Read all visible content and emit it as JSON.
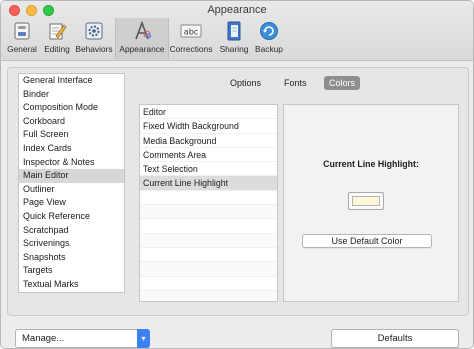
{
  "window": {
    "title": "Appearance"
  },
  "toolbar": [
    {
      "id": "general",
      "label": "General",
      "icon": "general-switch-icon"
    },
    {
      "id": "editing",
      "label": "Editing",
      "icon": "pencil-note-icon"
    },
    {
      "id": "behaviors",
      "label": "Behaviors",
      "icon": "gear-box-icon"
    },
    {
      "id": "appearance",
      "label": "Appearance",
      "icon": "letter-a-palette-icon",
      "selected": true
    },
    {
      "id": "corrections",
      "label": "Corrections",
      "icon": "abc-icon"
    },
    {
      "id": "sharing",
      "label": "Sharing",
      "icon": "document-share-icon"
    },
    {
      "id": "backup",
      "label": "Backup",
      "icon": "backup-arrows-icon"
    }
  ],
  "sidebar": {
    "items": [
      "General Interface",
      "Binder",
      "Composition Mode",
      "Corkboard",
      "Full Screen",
      "Index Cards",
      "Inspector & Notes",
      "Main Editor",
      "Outliner",
      "Page View",
      "Quick Reference",
      "Scratchpad",
      "Scrivenings",
      "Snapshots",
      "Targets",
      "Textual Marks"
    ],
    "selected": "Main Editor"
  },
  "tabs": {
    "options": "Options",
    "fonts": "Fonts",
    "colors": "Colors",
    "selected": "Colors"
  },
  "color_list": {
    "items": [
      "Editor",
      "Fixed Width Background",
      "Media Background",
      "Comments Area",
      "Text Selection",
      "Current Line Highlight"
    ],
    "selected": "Current Line Highlight"
  },
  "detail": {
    "label": "Current Line Highlight:",
    "swatch_color": "#fdf6d8",
    "use_default_button": "Use Default Color"
  },
  "footer": {
    "manage_label": "Manage...",
    "defaults_button": "Defaults"
  },
  "colors": {
    "selected_row": "#dcdcdc",
    "accent": "#3b82f6"
  }
}
